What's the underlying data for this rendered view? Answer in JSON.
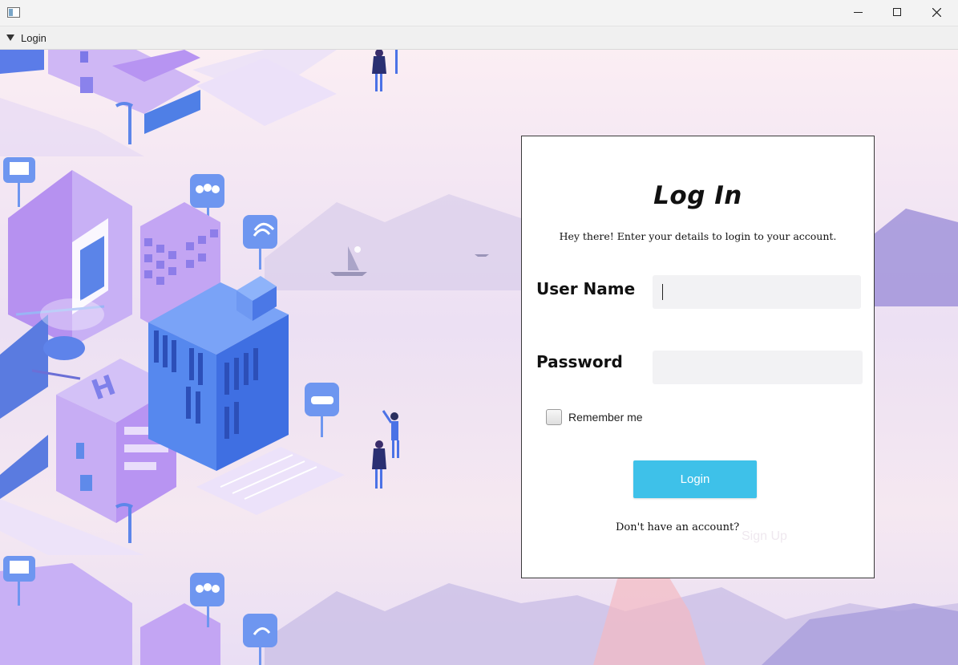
{
  "window": {
    "app_icon": "window-app-icon",
    "controls": [
      "minimize-icon",
      "maximize-icon",
      "close-icon"
    ]
  },
  "menubar": {
    "menu_label": "Login",
    "menu_icon": "triangle-down-icon"
  },
  "card": {
    "title": "Log In",
    "subtitle": "Hey there! Enter your details to login to your account.",
    "username_label": "User Name",
    "username_value": "",
    "password_label": "Password",
    "password_value": "",
    "remember_label": "Remember me",
    "remember_checked": false,
    "login_button": "Login",
    "no_account_text": "Don't have an account?",
    "signup_link": "Sign Up"
  },
  "colors": {
    "accent": "#3ec1e9",
    "field_bg": "#f2f2f4",
    "signup_link": "#efe8ef"
  }
}
